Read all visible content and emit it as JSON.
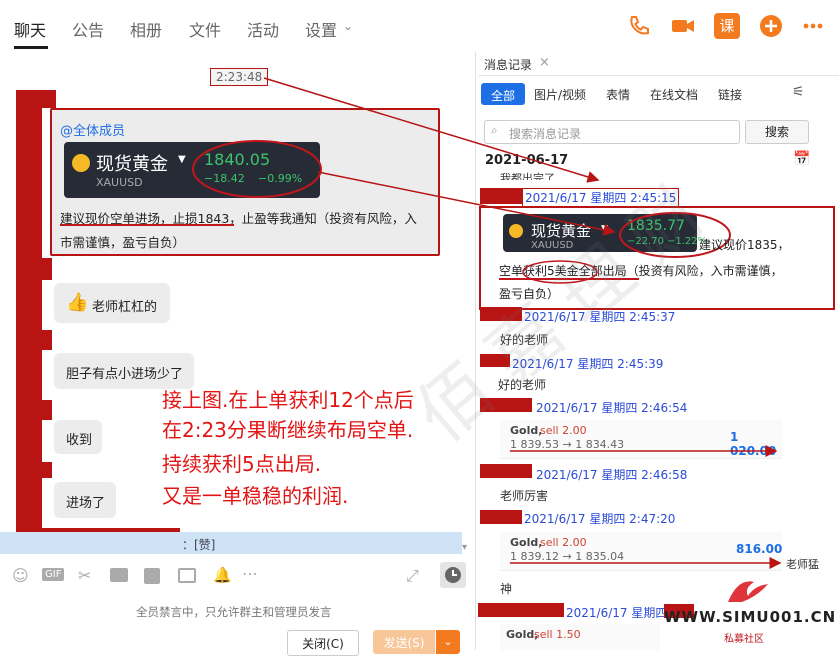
{
  "tabs": [
    "聊天",
    "公告",
    "相册",
    "文件",
    "活动",
    "设置"
  ],
  "top_icons": [
    "phone-icon",
    "video-icon",
    "course-icon",
    "add-icon",
    "more-icon"
  ],
  "top_course_label": "课",
  "chat": {
    "time_stamp": "2:23:48",
    "at_all": "@全体成员",
    "ticker1": {
      "name": "现货黄金",
      "symbol": "XAUUSD",
      "price": "1840.05",
      "change": "−18.42",
      "pct": "−0.99%"
    },
    "msg1_line1": "建议现价空单进场，止损1843，止盈等我通知（投资有风险，入",
    "msg1_line2": "市需谨慎，盈亏自负）",
    "msg2": "老师杠杠的",
    "msg3": "胆子有点小进场少了",
    "msg4": "收到",
    "msg5": "进场了",
    "quote_bar": "：[赞]",
    "annotation": [
      "接上图.在上单获利12个点后",
      "在2:23分果断继续布局空单.",
      "持续获利5点出局.",
      "又是一单稳稳的利润."
    ],
    "muted_notice": "全员禁言中，只允许群主和管理员发言",
    "close_btn": "关闭(C)",
    "send_btn": "发送(S)"
  },
  "history": {
    "title": "消息记录",
    "filters": [
      "全部",
      "图片/视频",
      "表情",
      "在线文档",
      "链接"
    ],
    "search_placeholder": "搜索消息记录",
    "search_btn": "搜索",
    "date": "2021-06-17",
    "partial_text": "我都出完了",
    "ts1": "2021/6/17 星期四 2:45:15",
    "ticker2": {
      "name": "现货黄金",
      "symbol": "XAUUSD",
      "price": "1835.77",
      "change": "−22.70",
      "pct": "−1.22%"
    },
    "msg_a_tail": "建议现价1835，",
    "msg_a_line2": "空单获利5美金全部出局（投资有风险，入市需谨慎，",
    "msg_a_line3": "盈亏自负）",
    "ts2": "2021/6/17 星期四 2:45:37",
    "msg_b": "好的老师",
    "ts3": "2021/6/17 星期四 2:45:39",
    "msg_c": "好的老师",
    "ts4": "2021/6/17 星期四 2:46:54",
    "trade1": {
      "label": "Gold,",
      "side": "sell 2.00",
      "range": "1 839.53 → 1 834.43",
      "profit": "1 020.00"
    },
    "ts5": "2021/6/17 星期四 2:46:58",
    "msg_d": "老师厉害",
    "ts6": "2021/6/17 星期四 2:47:20",
    "trade2": {
      "label": "Gold,",
      "side": "sell 2.00",
      "range": "1 839.12 → 1 835.04",
      "profit": "816.00"
    },
    "msg_e_side": "老师猛",
    "msg_f": "神",
    "ts7": "2021/6/17 星期四",
    "trade3": {
      "label": "Gold,",
      "side": "sell 1.50"
    }
  },
  "watermark": {
    "text": "佰嘉理财",
    "logo_text": "WWW.SIMU001.CN",
    "logo_sub": "私募社区"
  },
  "colors": {
    "red": "#e21414",
    "blue_accent": "#1e6fe6",
    "orange": "#f47a20",
    "dark_red_mark": "#b81414"
  }
}
